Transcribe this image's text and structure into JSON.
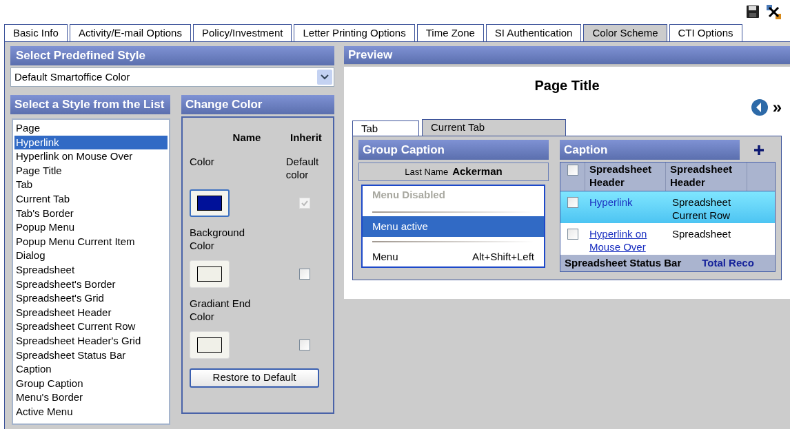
{
  "tabs": [
    {
      "label": "Basic Info",
      "selected": false
    },
    {
      "label": "Activity/E-mail Options",
      "selected": false
    },
    {
      "label": "Policy/Investment",
      "selected": false
    },
    {
      "label": "Letter Printing Options",
      "selected": false
    },
    {
      "label": "Time Zone",
      "selected": false
    },
    {
      "label": "SI Authentication",
      "selected": false
    },
    {
      "label": "Color Scheme",
      "selected": true
    },
    {
      "label": "CTI Options",
      "selected": false
    }
  ],
  "predefined": {
    "title": "Select Predefined Style",
    "value": "Default Smartoffice Color"
  },
  "style_list": {
    "title": "Select a Style from the List",
    "items": [
      {
        "label": "Page",
        "selected": false
      },
      {
        "label": "Hyperlink",
        "selected": true
      },
      {
        "label": "Hyperlink on Mouse Over",
        "selected": false
      },
      {
        "label": "Page Title",
        "selected": false
      },
      {
        "label": "Tab",
        "selected": false
      },
      {
        "label": "Current Tab",
        "selected": false
      },
      {
        "label": "Tab's Border",
        "selected": false
      },
      {
        "label": "Popup Menu",
        "selected": false
      },
      {
        "label": "Popup Menu Current Item",
        "selected": false
      },
      {
        "label": "Dialog",
        "selected": false
      },
      {
        "label": "Spreadsheet",
        "selected": false
      },
      {
        "label": "Spreadsheet's Border",
        "selected": false
      },
      {
        "label": "Spreadsheet's Grid",
        "selected": false
      },
      {
        "label": "Spreadsheet Header",
        "selected": false
      },
      {
        "label": "Spreadsheet Current Row",
        "selected": false
      },
      {
        "label": "Spreadsheet Header's Grid",
        "selected": false
      },
      {
        "label": "Spreadsheet Status Bar",
        "selected": false
      },
      {
        "label": "Caption",
        "selected": false
      },
      {
        "label": "Group Caption",
        "selected": false
      },
      {
        "label": "Menu's Border",
        "selected": false
      },
      {
        "label": "Active Menu",
        "selected": false
      }
    ]
  },
  "change_color": {
    "title": "Change Color",
    "col_name": "Name",
    "col_inherit": "Inherit",
    "rows": [
      {
        "label": "Color",
        "inherit_label": "Default color",
        "color": "#001199",
        "checked": true,
        "disabled": true
      },
      {
        "label": "Background Color",
        "color": "#f0f0e8",
        "checked": false,
        "disabled": false
      },
      {
        "label": "Gradiant End Color",
        "color": "#f0f0e8",
        "checked": false,
        "disabled": false
      }
    ],
    "restore": "Restore to Default"
  },
  "preview": {
    "title": "Preview",
    "page_title": "Page Title",
    "next": "»",
    "tabs": [
      {
        "label": "Tab",
        "selected": false
      },
      {
        "label": "Current Tab",
        "selected": true
      }
    ],
    "group_caption": "Group Caption",
    "field_label": "Last Name",
    "field_value": "Ackerman",
    "menu": [
      {
        "label": "Menu Disabled",
        "kind": "disabled"
      },
      {
        "label": "Menu active",
        "kind": "active"
      },
      {
        "label": "Menu",
        "shortcut": "Alt+Shift+Left",
        "kind": "normal"
      }
    ],
    "caption": "Caption",
    "sheet": {
      "header_checked": false,
      "columns": [
        "Spreadsheet Header",
        "Spreadsheet Header"
      ],
      "rows": [
        {
          "link": "Hyperlink",
          "cell": "Spreadsheet Current Row",
          "selected": true,
          "hover": false,
          "checked": false
        },
        {
          "link": "Hyperlink on Mouse Over",
          "cell": "Spreadsheet",
          "selected": false,
          "hover": true,
          "checked": false
        }
      ],
      "status": "Spreadsheet Status Bar",
      "total": "Total Reco"
    }
  }
}
